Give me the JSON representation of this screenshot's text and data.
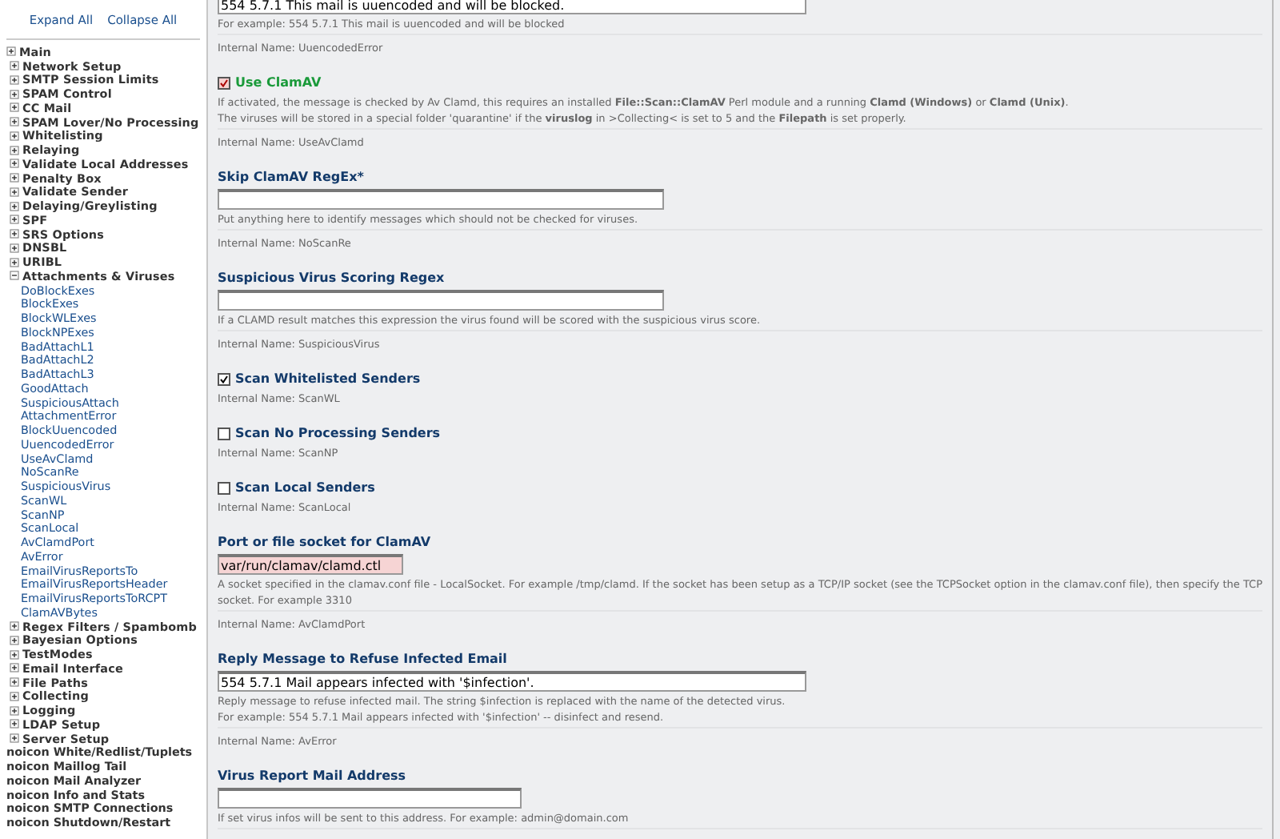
{
  "sidebar": {
    "links": [
      "Expand All",
      "Collapse All"
    ],
    "tree": [
      {
        "label": "Main",
        "expanded": false
      },
      {
        "label": "Network Setup",
        "expanded": false
      },
      {
        "label": "SMTP Session Limits",
        "expanded": false
      },
      {
        "label": "SPAM Control",
        "expanded": false
      },
      {
        "label": "CC Mail",
        "expanded": false
      },
      {
        "label": "SPAM Lover/No Processing",
        "expanded": false
      },
      {
        "label": "Whitelisting",
        "expanded": false
      },
      {
        "label": "Relaying",
        "expanded": false
      },
      {
        "label": "Validate Local Addresses",
        "expanded": false
      },
      {
        "label": "Penalty Box",
        "expanded": false
      },
      {
        "label": "Validate Sender",
        "expanded": false
      },
      {
        "label": "Delaying/Greylisting",
        "expanded": false
      },
      {
        "label": "SPF",
        "expanded": false
      },
      {
        "label": "SRS Options",
        "expanded": false
      },
      {
        "label": "DNSBL",
        "expanded": false
      },
      {
        "label": "URIBL",
        "expanded": false
      },
      {
        "label": "Attachments & Viruses",
        "expanded": true,
        "children": [
          {
            "label": "DoBlockExes"
          },
          {
            "label": "BlockExes"
          },
          {
            "label": "BlockWLExes"
          },
          {
            "label": "BlockNPExes"
          },
          {
            "label": "BadAttachL1"
          },
          {
            "label": "BadAttachL2"
          },
          {
            "label": "BadAttachL3"
          },
          {
            "label": "GoodAttach"
          },
          {
            "label": "SuspiciousAttach"
          },
          {
            "label": "AttachmentError"
          },
          {
            "label": "BlockUuencoded"
          },
          {
            "label": "UuencodedError"
          },
          {
            "label": "UseAvClamd"
          },
          {
            "label": "NoScanRe"
          },
          {
            "label": "SuspiciousVirus"
          },
          {
            "label": "ScanWL"
          },
          {
            "label": "ScanNP"
          },
          {
            "label": "ScanLocal"
          },
          {
            "label": "AvClamdPort"
          },
          {
            "label": "AvError"
          },
          {
            "label": "EmailVirusReportsTo"
          },
          {
            "label": "EmailVirusReportsHeader"
          },
          {
            "label": "EmailVirusReportsToRCPT"
          },
          {
            "label": "ClamAVBytes"
          }
        ]
      },
      {
        "label": "Regex Filters / Spambomb",
        "expanded": false
      },
      {
        "label": "Bayesian Options",
        "expanded": false
      },
      {
        "label": "TestModes",
        "expanded": false
      },
      {
        "label": "Email Interface",
        "expanded": false
      },
      {
        "label": "File Paths",
        "expanded": false
      },
      {
        "label": "Collecting",
        "expanded": false
      },
      {
        "label": "Logging",
        "expanded": false
      },
      {
        "label": "LDAP Setup",
        "expanded": false
      },
      {
        "label": "Server Setup",
        "expanded": false
      }
    ],
    "pages": [
      "noicon White/Redlist/Tuplets",
      "noicon Maillog Tail",
      "noicon Mail Analyzer",
      "noicon Info and Stats",
      "noicon SMTP Connections",
      "noicon Shutdown/Restart"
    ]
  },
  "settings": [
    {
      "kind": "text",
      "value": "554 5.7.1 This mail is uuencoded and will be blocked.",
      "changed": false,
      "description": [
        "For example: 554 5.7.1 This mail is uuencoded and will be blocked"
      ],
      "internal": "Internal Name: UuencodedError"
    },
    {
      "kind": "checkbox",
      "title": "Use ClamAV",
      "checked": true,
      "changed": true,
      "description": [
        "If activated, the message is checked by Av Clamd, this requires an installed **File::Scan::ClamAV** Perl module and a running **Clamd (Windows)** or **Clamd (Unix)**.",
        "The viruses will be stored in a special folder 'quarantine' if the **viruslog** in >Collecting< is set to 5 and the **Filepath** is set properly."
      ],
      "internal": "Internal Name: UseAvClamd"
    },
    {
      "kind": "text",
      "title": "Skip ClamAV RegEx*",
      "changed": false,
      "description": [
        "Put anything here to identify messages which should not be checked for viruses."
      ],
      "internal": "Internal Name: NoScanRe"
    },
    {
      "kind": "text",
      "title": "Suspicious Virus Scoring Regex",
      "changed": false,
      "description": [
        "If a CLAMD result matches this expression the virus found will be scored with the suspicious virus score."
      ],
      "internal": "Internal Name: SuspiciousVirus"
    },
    {
      "kind": "checkbox",
      "title": "Scan Whitelisted Senders",
      "checked": true,
      "changed": false,
      "internal": "Internal Name: ScanWL"
    },
    {
      "kind": "checkbox",
      "title": "Scan No Processing Senders",
      "checked": false,
      "changed": false,
      "internal": "Internal Name: ScanNP"
    },
    {
      "kind": "checkbox",
      "title": "Scan Local Senders",
      "checked": false,
      "changed": false,
      "internal": "Internal Name: ScanLocal"
    },
    {
      "kind": "text",
      "title": "Port or file socket for ClamAV",
      "value": "var/run/clamav/clamd.ctl",
      "changed": true,
      "description": [
        "A socket specified in the clamav.conf file - LocalSocket. For example /tmp/clamd. If the socket has been setup as a TCP/IP socket (see the TCPSocket option in the clamav.conf file), then specify the TCP socket. For example 3310"
      ],
      "internal": "Internal Name: AvClamdPort"
    },
    {
      "kind": "text",
      "title": "Reply Message to Refuse Infected Email",
      "value": "554 5.7.1 Mail appears infected with '$infection'.",
      "changed": false,
      "description": [
        "Reply message to refuse infected mail. The string $infection is replaced with the name of the detected virus.",
        "For example: 554 5.7.1 Mail appears infected with '$infection' -- disinfect and resend."
      ],
      "internal": "Internal Name: AvError"
    },
    {
      "kind": "text",
      "title": "Virus Report Mail Address",
      "changed": false,
      "description": [
        "If set virus infos will be sent to this address. For example: admin@domain.com"
      ]
    }
  ]
}
